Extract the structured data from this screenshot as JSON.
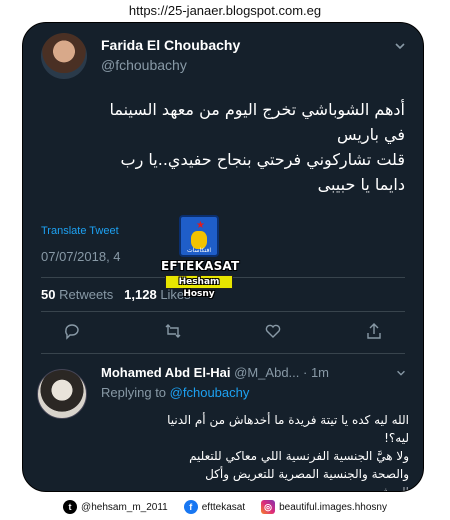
{
  "url": "https://25-janaer.blogspot.com.eg",
  "tweet": {
    "author_name": "Farida El Choubachy",
    "author_handle": "@fchoubachy",
    "text_lines": [
      "أدهم الشوباشي تخرج اليوم من معهد السينما",
      "في باريس",
      "قلت تشاركوني فرحتي بنجاح حفيدي..يا رب",
      "دايما يا حبيبى"
    ],
    "translate_label": "Translate Tweet",
    "timestamp": "07/07/2018, 4",
    "retweets_count": "50",
    "retweets_label": "Retweets",
    "likes_count": "1,128",
    "likes_label": "Likes"
  },
  "reply": {
    "author_name": "Mohamed Abd El-Hai",
    "author_handle": "@M_Abd...",
    "time": "· 1m",
    "replying_prefix": "Replying to",
    "replying_mention": "@fchoubachy",
    "text_lines": [
      "الله ليه كده يا تيتة فريدة ما أخدهاش من أم الدنيا",
      "ليه؟!",
      "ولا هيَّ الجنسية الفرنسية اللي معاكي للتعليم",
      "والصحة والجنسية المصرية للتعريض وأكل",
      "العيش"
    ]
  },
  "watermark": {
    "arabic": "افتكاسات",
    "title": "EFTEKASAT",
    "subtitle": "Hesham Hosny"
  },
  "footer": {
    "twitter": "@hehsam_m_2011",
    "facebook": "efttekasat",
    "instagram": "beautiful.images.hhosny"
  },
  "icons": [
    "chevron-down-icon",
    "reply-icon",
    "retweet-icon",
    "like-icon",
    "share-icon",
    "twitter-icon",
    "facebook-icon",
    "instagram-icon"
  ],
  "colors": {
    "background": "#15202b",
    "text": "#ffffff",
    "muted": "#8899a6",
    "accent": "#1da1f2"
  }
}
